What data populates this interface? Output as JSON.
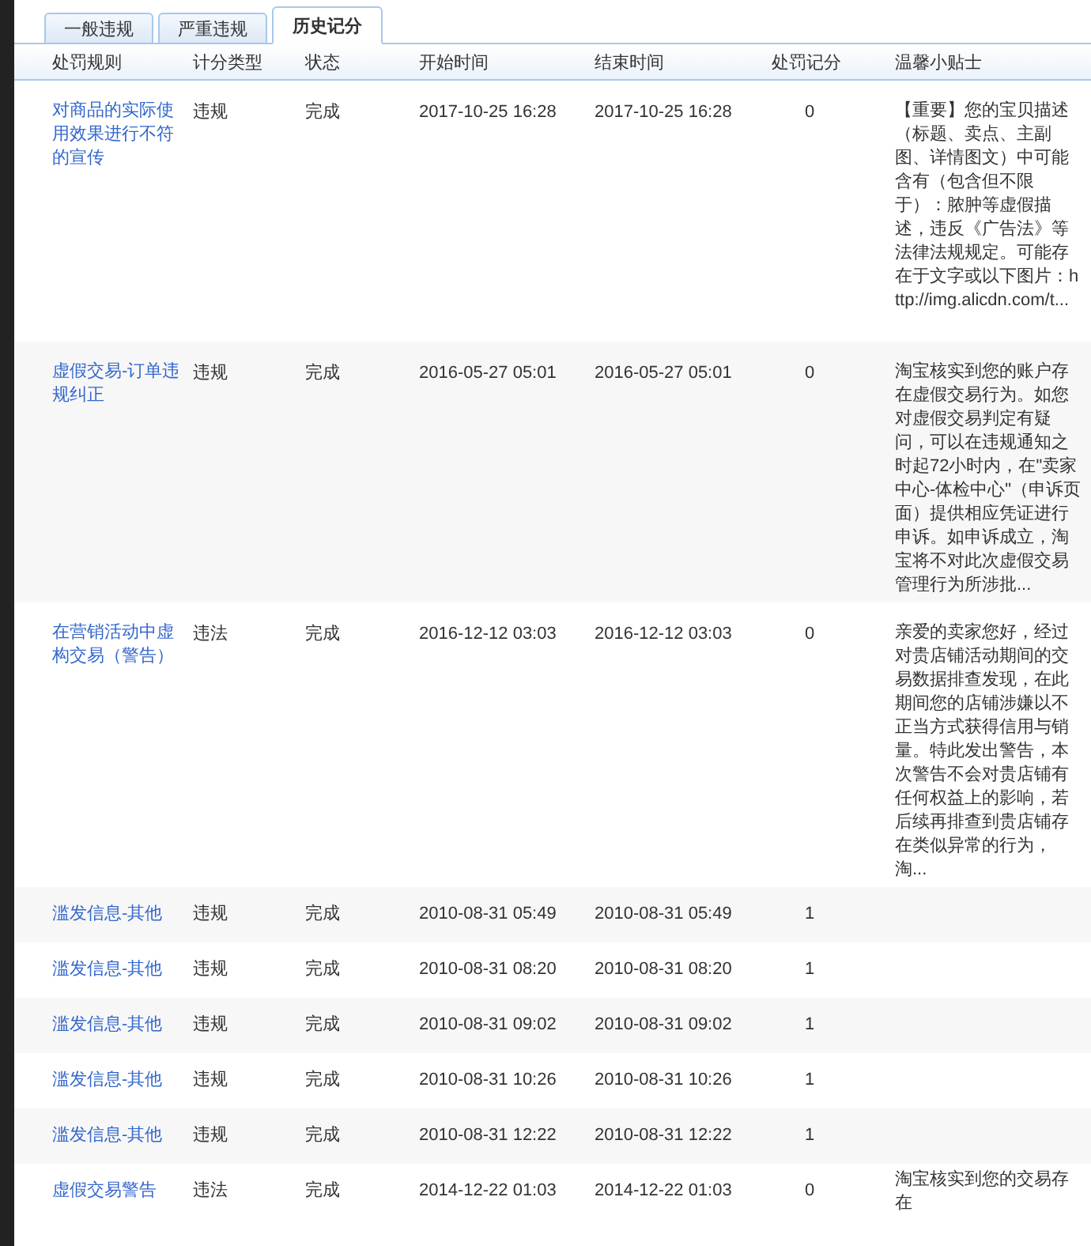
{
  "tabs": [
    {
      "label": "一般违规",
      "selected": false
    },
    {
      "label": "严重违规",
      "selected": false
    },
    {
      "label": "历史记分",
      "selected": true
    }
  ],
  "table": {
    "columns": [
      "处罚规则",
      "计分类型",
      "状态",
      "开始时间",
      "结束时间",
      "处罚记分",
      "温馨小贴士"
    ],
    "rows": [
      {
        "rule": "对商品的实际使用效果进行不符的宣传",
        "type": "违规",
        "status": "完成",
        "start": "2017-10-25 16:28",
        "end": "2017-10-25 16:28",
        "score": "0",
        "tip": "【重要】您的宝贝描述（标题、卖点、主副图、详情图文）中可能含有（包含但不限于）：脓肿等虚假描述，违反《广告法》等法律法规规定。可能存在于文字或以下图片：http://img.alicdn.com/t..."
      },
      {
        "rule": "虚假交易-订单违规纠正",
        "type": "违规",
        "status": "完成",
        "start": "2016-05-27 05:01",
        "end": "2016-05-27 05:01",
        "score": "0",
        "tip": "淘宝核实到您的账户存在虚假交易行为。如您对虚假交易判定有疑问，可以在违规通知之时起72小时内，在\"卖家中心-体检中心\"（申诉页面）提供相应凭证进行申诉。如申诉成立，淘宝将不对此次虚假交易管理行为所涉批..."
      },
      {
        "rule": "在营销活动中虚构交易（警告）",
        "type": "违法",
        "status": "完成",
        "start": "2016-12-12 03:03",
        "end": "2016-12-12 03:03",
        "score": "0",
        "tip": "亲爱的卖家您好，经过对贵店铺活动期间的交易数据排查发现，在此期间您的店铺涉嫌以不正当方式获得信用与销量。特此发出警告，本次警告不会对贵店铺有任何权益上的影响，若后续再排查到贵店铺存在类似异常的行为，淘..."
      },
      {
        "rule": "滥发信息-其他",
        "type": "违规",
        "status": "完成",
        "start": "2010-08-31 05:49",
        "end": "2010-08-31 05:49",
        "score": "1"
      },
      {
        "rule": "滥发信息-其他",
        "type": "违规",
        "status": "完成",
        "start": "2010-08-31 08:20",
        "end": "2010-08-31 08:20",
        "score": "1"
      },
      {
        "rule": "滥发信息-其他",
        "type": "违规",
        "status": "完成",
        "start": "2010-08-31 09:02",
        "end": "2010-08-31 09:02",
        "score": "1"
      },
      {
        "rule": "滥发信息-其他",
        "type": "违规",
        "status": "完成",
        "start": "2010-08-31 10:26",
        "end": "2010-08-31 10:26",
        "score": "1"
      },
      {
        "rule": "滥发信息-其他",
        "type": "违规",
        "status": "完成",
        "start": "2010-08-31 12:22",
        "end": "2010-08-31 12:22",
        "score": "1"
      },
      {
        "rule": "虚假交易警告",
        "type": "违法",
        "status": "完成",
        "start": "2014-12-22 01:03",
        "end": "2014-12-22 01:03",
        "score": "0",
        "tip": "淘宝核实到您的交易存在"
      }
    ]
  }
}
